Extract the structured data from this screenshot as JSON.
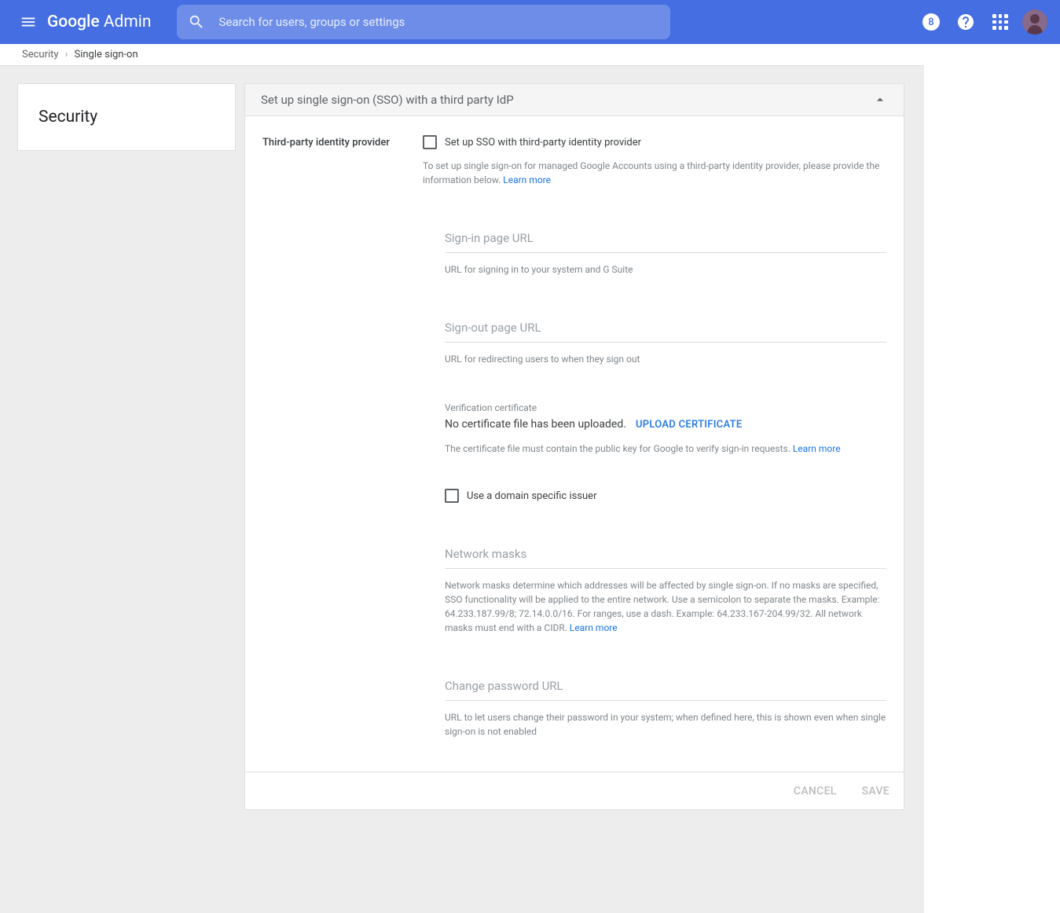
{
  "header": {
    "logo_google": "Google",
    "logo_admin": " Admin",
    "search_placeholder": "Search for users, groups or settings",
    "badge": "8"
  },
  "breadcrumb": {
    "root": "Security",
    "current": "Single sign-on"
  },
  "sidebar": {
    "title": "Security"
  },
  "card": {
    "title": "Set up single sign-on (SSO) with a third party IdP",
    "section_label": "Third-party identity provider",
    "checkbox_label": "Set up SSO with third-party identity provider",
    "intro_text": "To set up single sign-on for managed Google Accounts using a third-party identity provider, please provide the information below. ",
    "learn_more": "Learn more",
    "fields": {
      "signin_label": "Sign-in page URL",
      "signin_help": "URL for signing in to your system and G Suite",
      "signout_label": "Sign-out page URL",
      "signout_help": "URL for redirecting users to when they sign out",
      "cert_label": "Verification certificate",
      "cert_status": "No certificate file has been uploaded.",
      "upload_btn": "UPLOAD CERTIFICATE",
      "cert_help": "The certificate file must contain the public key for Google to verify sign-in requests. ",
      "domain_issuer_label": "Use a domain specific issuer",
      "masks_label": "Network masks",
      "masks_help": "Network masks determine which addresses will be affected by single sign-on. If no masks are specified, SSO functionality will be applied to the entire network. Use a semicolon to separate the masks. Example: 64.233.187.99/8; 72.14.0.0/16. For ranges, use a dash. Example: 64.233.167-204.99/32. All network masks must end with a CIDR. ",
      "pw_label": "Change password URL",
      "pw_help": "URL to let users change their password in your system; when defined here, this is shown even when single sign-on is not enabled"
    },
    "footer": {
      "cancel": "CANCEL",
      "save": "SAVE"
    }
  }
}
